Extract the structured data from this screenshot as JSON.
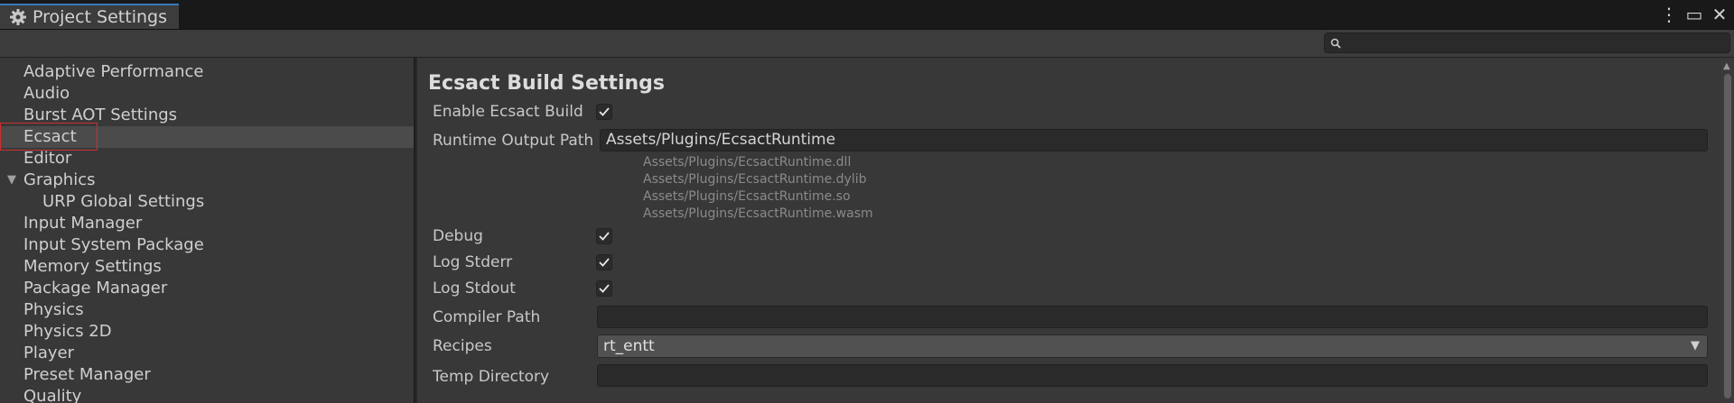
{
  "window": {
    "tab_title": "Project Settings",
    "controls": [
      "⋮",
      "▭",
      "✕"
    ]
  },
  "search": {
    "placeholder": "",
    "value": ""
  },
  "sidebar": {
    "items": [
      {
        "label": "Adaptive Performance"
      },
      {
        "label": "Audio"
      },
      {
        "label": "Burst AOT Settings"
      },
      {
        "label": "Ecsact",
        "selected": true
      },
      {
        "label": "Editor"
      },
      {
        "label": "Graphics",
        "expanded": true
      },
      {
        "label": "URP Global Settings",
        "child": true
      },
      {
        "label": "Input Manager"
      },
      {
        "label": "Input System Package"
      },
      {
        "label": "Memory Settings"
      },
      {
        "label": "Package Manager"
      },
      {
        "label": "Physics"
      },
      {
        "label": "Physics 2D"
      },
      {
        "label": "Player"
      },
      {
        "label": "Preset Manager"
      },
      {
        "label": "Quality"
      }
    ]
  },
  "content": {
    "title": "Ecsact Build Settings",
    "enable_build": {
      "label": "Enable Ecsact Build",
      "checked": true
    },
    "runtime_output": {
      "label": "Runtime Output Path",
      "value": "Assets/Plugins/EcsactRuntime",
      "hints": [
        "Assets/Plugins/EcsactRuntime.dll",
        "Assets/Plugins/EcsactRuntime.dylib",
        "Assets/Plugins/EcsactRuntime.so",
        "Assets/Plugins/EcsactRuntime.wasm"
      ]
    },
    "debug": {
      "label": "Debug",
      "checked": true
    },
    "log_stderr": {
      "label": "Log Stderr",
      "checked": true
    },
    "log_stdout": {
      "label": "Log Stdout",
      "checked": true
    },
    "compiler_path": {
      "label": "Compiler Path",
      "value": ""
    },
    "recipes": {
      "label": "Recipes",
      "value": "rt_entt"
    },
    "temp_directory": {
      "label": "Temp Directory",
      "value": ""
    }
  },
  "colors": {
    "accent": "#3a79bb",
    "selection_box": "#d03030",
    "panel": "#383838",
    "field": "#2a2a2a"
  }
}
